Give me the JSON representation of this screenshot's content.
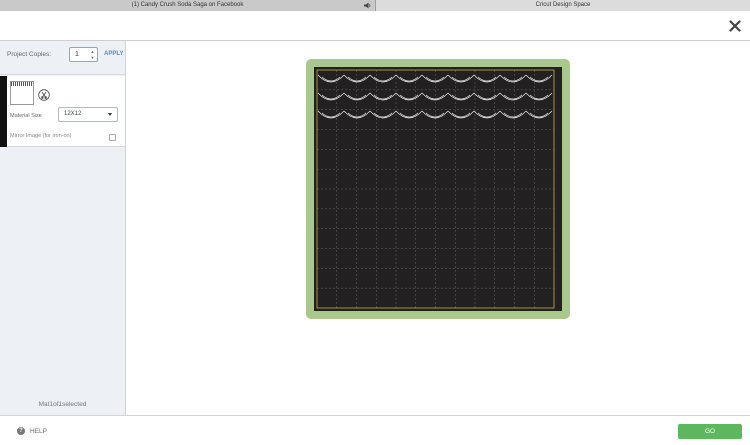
{
  "browser": {
    "tabs": [
      {
        "title": "(1) Candy Crush Soda Saga on Facebook"
      },
      {
        "title": "Cricut Design Space"
      }
    ]
  },
  "sidebar": {
    "copies_label": "Project Copies:",
    "copies_value": "1",
    "apply_label": "APPLY",
    "material_size_label": "Material Size",
    "material_size_value": "12X12",
    "mirror_label": "Mirror Image (for iron-on)",
    "mirror_checked": false,
    "selection_status": "Mat1of1selected"
  },
  "canvas": {
    "mat_color": "#a9c98a",
    "grid_color": "#222020",
    "cut_line_color": "#c8b04a"
  },
  "footer": {
    "help_label": "HELP",
    "go_label": "GO"
  },
  "colors": {
    "accent_blue": "#4a90c8",
    "go_green": "#5bb85d"
  }
}
